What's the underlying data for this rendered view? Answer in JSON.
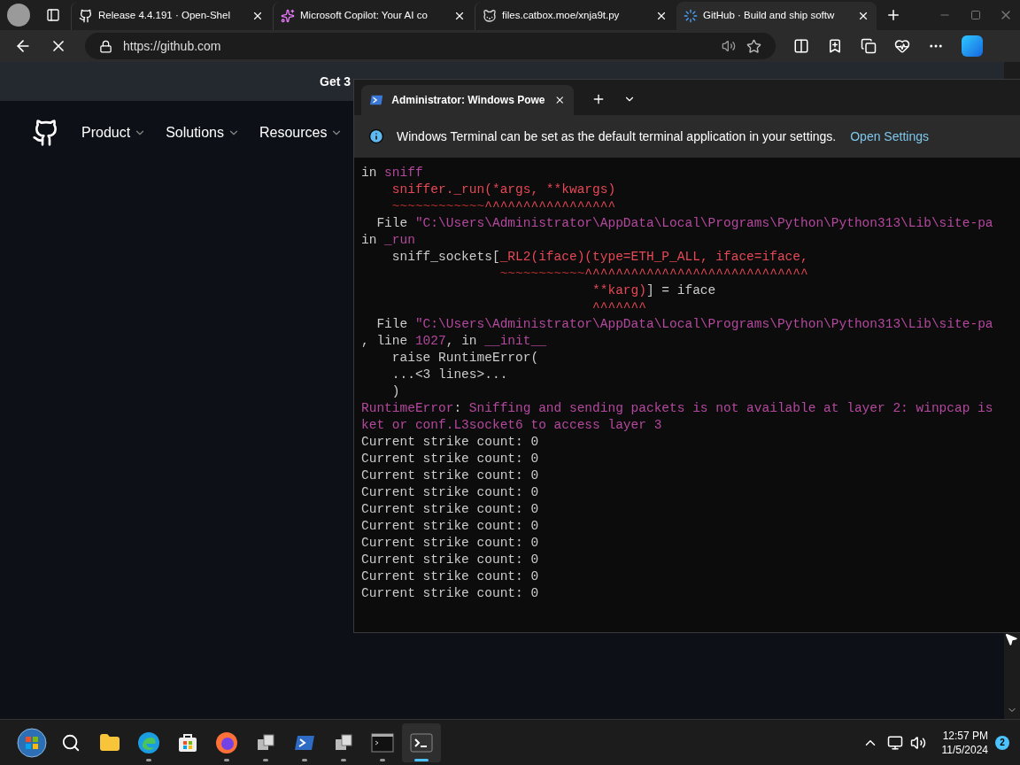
{
  "browser": {
    "tabs": [
      {
        "title": "Release 4.4.191 · Open-Shel",
        "kind": "github",
        "selected": false
      },
      {
        "title": "Microsoft Copilot: Your AI co",
        "kind": "copilot",
        "selected": false
      },
      {
        "title": "files.catbox.moe/xnja9t.py",
        "kind": "cat",
        "selected": false
      },
      {
        "title": "GitHub · Build and ship softw",
        "kind": "loading",
        "selected": true
      }
    ],
    "url": "https://github.com"
  },
  "page": {
    "banner": "Get 3",
    "nav": [
      "Product",
      "Solutions",
      "Resources"
    ]
  },
  "terminal": {
    "tab_title": "Administrator: Windows Powe",
    "notice": {
      "text": "Windows Terminal can be set as the default terminal application in your settings.",
      "link": "Open Settings"
    },
    "lines": [
      [
        {
          "kind": "plain",
          "text": "in "
        },
        {
          "kind": "magenta",
          "text": "sniff"
        }
      ],
      [
        {
          "kind": "red",
          "text": "    sniffer._run(*args, **kwargs)"
        }
      ],
      [
        {
          "kind": "tilde",
          "text": "    ~~~~~~~~~~~~"
        },
        {
          "kind": "red",
          "text": "^^^^^^^^^^^^^^^^^"
        }
      ],
      [
        {
          "kind": "plain",
          "text": "  File "
        },
        {
          "kind": "magenta",
          "text": "\"C:\\Users\\Administrator\\AppData\\Local\\Programs\\Python\\Python313\\Lib\\site-pa"
        }
      ],
      [
        {
          "kind": "plain",
          "text": "in "
        },
        {
          "kind": "magenta",
          "text": "_run"
        }
      ],
      [
        {
          "kind": "plain",
          "text": "    sniff_sockets["
        },
        {
          "kind": "red",
          "text": "_RL2(iface)(type=ETH_P_ALL, iface=iface,"
        }
      ],
      [
        {
          "kind": "tilde",
          "text": "                  ~~~~~~~~~~~"
        },
        {
          "kind": "red",
          "text": "^^^^^^^^^^^^^^^^^^^^^^^^^^^^^"
        }
      ],
      [
        {
          "kind": "red",
          "text": "                              **karg)"
        },
        {
          "kind": "plain",
          "text": "] = iface"
        }
      ],
      [
        {
          "kind": "red",
          "text": "                              ^^^^^^^"
        }
      ],
      [
        {
          "kind": "plain",
          "text": "  File "
        },
        {
          "kind": "magenta",
          "text": "\"C:\\Users\\Administrator\\AppData\\Local\\Programs\\Python\\Python313\\Lib\\site-pa"
        }
      ],
      [
        {
          "kind": "plain",
          "text": ", line "
        },
        {
          "kind": "magenta",
          "text": "1027"
        },
        {
          "kind": "plain",
          "text": ", in "
        },
        {
          "kind": "magenta",
          "text": "__init__"
        }
      ],
      [
        {
          "kind": "plain",
          "text": "    raise RuntimeError("
        }
      ],
      [
        {
          "kind": "plain",
          "text": "    ...<3 lines>..."
        }
      ],
      [
        {
          "kind": "plain",
          "text": "    )"
        }
      ],
      [
        {
          "kind": "magenta",
          "text": "RuntimeError"
        },
        {
          "kind": "plain",
          "text": ": "
        },
        {
          "kind": "magenta",
          "text": "Sniffing and sending packets is not available at layer 2: winpcap is"
        }
      ],
      [
        {
          "kind": "magenta",
          "text": "ket or conf.L3socket6 to access layer 3"
        }
      ],
      [
        {
          "kind": "plain",
          "text": "Current strike count: 0"
        }
      ],
      [
        {
          "kind": "plain",
          "text": "Current strike count: 0"
        }
      ],
      [
        {
          "kind": "plain",
          "text": "Current strike count: 0"
        }
      ],
      [
        {
          "kind": "plain",
          "text": "Current strike count: 0"
        }
      ],
      [
        {
          "kind": "plain",
          "text": "Current strike count: 0"
        }
      ],
      [
        {
          "kind": "plain",
          "text": "Current strike count: 0"
        }
      ],
      [
        {
          "kind": "plain",
          "text": "Current strike count: 0"
        }
      ],
      [
        {
          "kind": "plain",
          "text": "Current strike count: 0"
        }
      ],
      [
        {
          "kind": "plain",
          "text": "Current strike count: 0"
        }
      ],
      [
        {
          "kind": "plain",
          "text": "Current strike count: 0"
        }
      ]
    ]
  },
  "taskbar": {
    "apps": [
      {
        "kind": "start",
        "open": false,
        "selected": false
      },
      {
        "kind": "search",
        "open": false,
        "selected": false
      },
      {
        "kind": "folder",
        "open": false,
        "selected": false
      },
      {
        "kind": "edge",
        "open": true,
        "selected": false
      },
      {
        "kind": "store",
        "open": false,
        "selected": false
      },
      {
        "kind": "firefox",
        "open": true,
        "selected": false
      },
      {
        "kind": "app",
        "open": true,
        "selected": false
      },
      {
        "kind": "powershell",
        "open": true,
        "selected": false
      },
      {
        "kind": "app",
        "open": true,
        "selected": false
      },
      {
        "kind": "cmd",
        "open": true,
        "selected": false
      },
      {
        "kind": "terminal",
        "open": true,
        "selected": true
      }
    ],
    "time": "12:57 PM",
    "date": "11/5/2024",
    "notifications": "2"
  }
}
